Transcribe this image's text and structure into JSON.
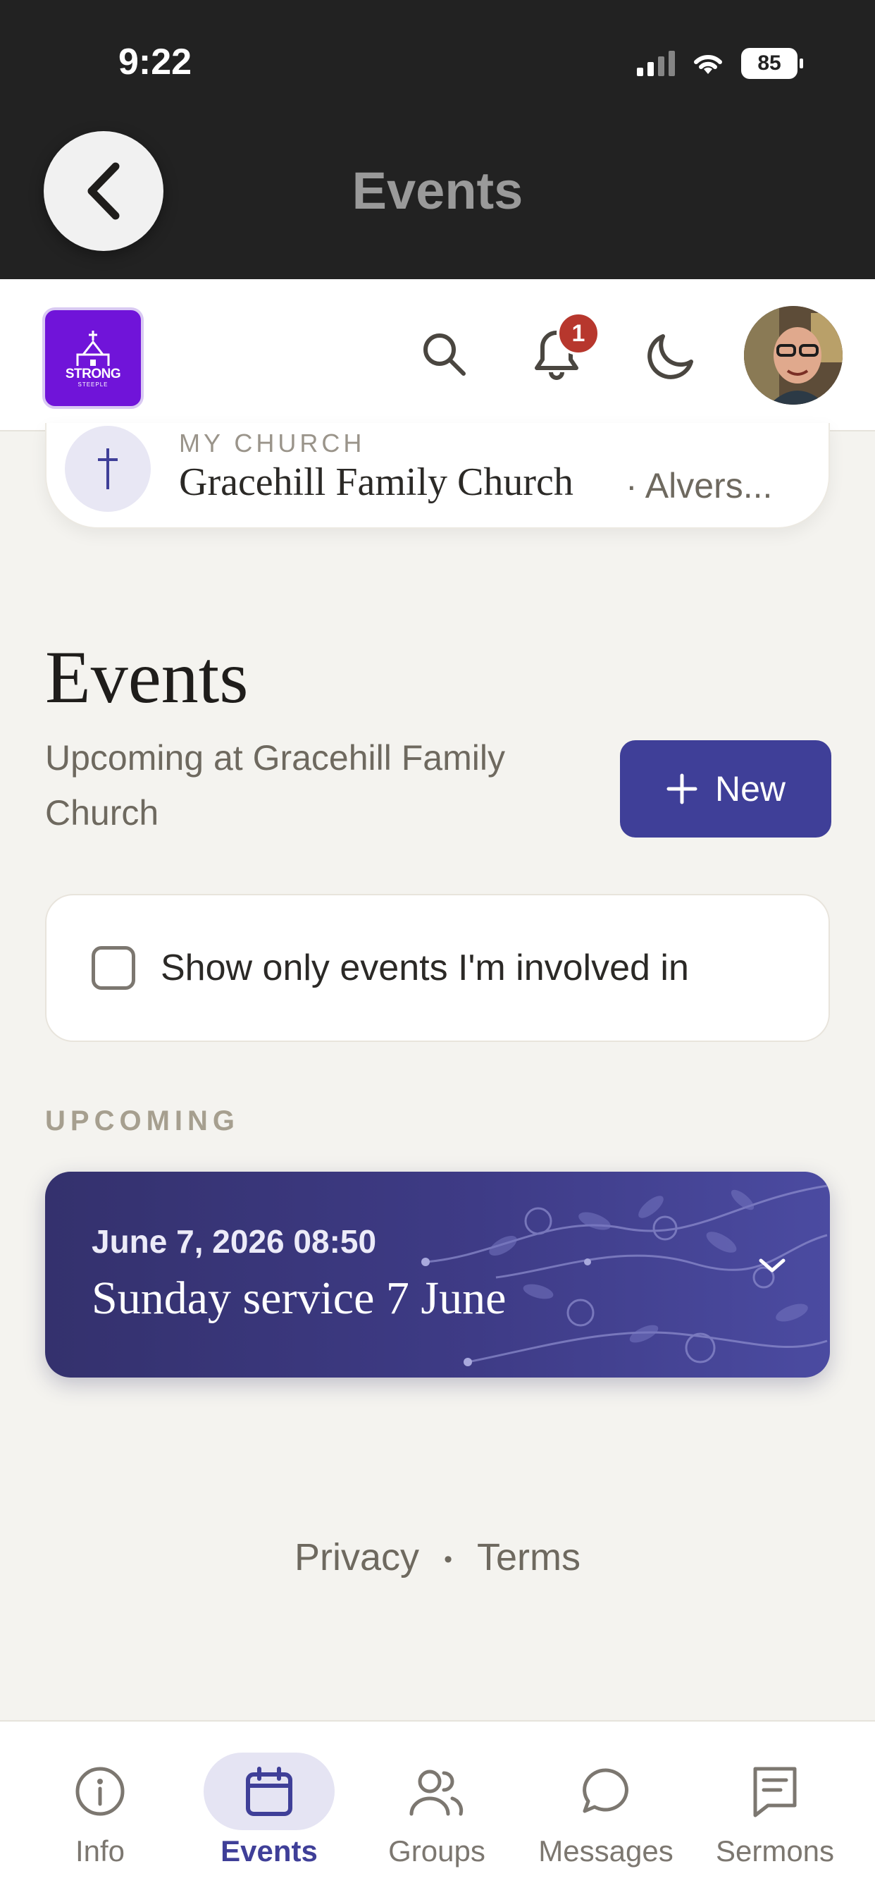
{
  "status_bar": {
    "time": "9:22",
    "battery": "85"
  },
  "header": {
    "title": "Events"
  },
  "app": {
    "logo_text": "STRONG",
    "logo_sub": "STEEPLE",
    "notification_count": "1"
  },
  "church": {
    "label": "MY CHURCH",
    "name": "Gracehill Family Church",
    "location": "· Alvers..."
  },
  "page": {
    "title": "Events",
    "subtitle": "Upcoming at Gracehill Family Church",
    "new_button": "New"
  },
  "filter": {
    "label": "Show only events I'm involved in",
    "checked": false
  },
  "upcoming": {
    "section_label": "UPCOMING",
    "events": [
      {
        "date": "June 7, 2026 08:50",
        "title": "Sunday service 7 June"
      }
    ]
  },
  "footer": {
    "privacy": "Privacy",
    "separator": "•",
    "terms": "Terms"
  },
  "nav": {
    "items": [
      {
        "label": "Info",
        "icon": "info-icon"
      },
      {
        "label": "Events",
        "icon": "calendar-icon",
        "active": true
      },
      {
        "label": "Groups",
        "icon": "groups-icon"
      },
      {
        "label": "Messages",
        "icon": "chat-icon"
      },
      {
        "label": "Sermons",
        "icon": "sermon-icon"
      }
    ]
  },
  "colors": {
    "accent": "#3f3f98",
    "badge": "#b7372d",
    "logo": "#7014d9",
    "header": "#222222"
  }
}
